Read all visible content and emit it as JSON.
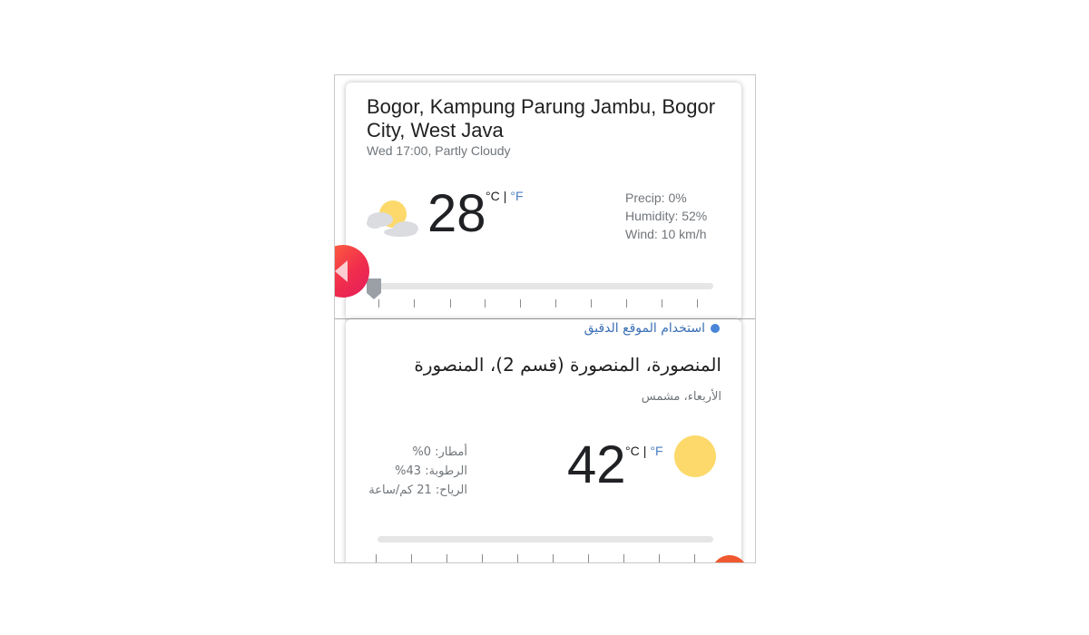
{
  "top_card": {
    "location": "Bogor, Kampung Parung Jambu, Bogor City, West Java",
    "subtitle": "Wed 17:00, Partly Cloudy",
    "icon": "partly-cloudy-icon",
    "temperature": "28",
    "unit_c": "°C",
    "unit_sep": "|",
    "unit_f": "°F",
    "precip": "Precip: 0%",
    "humidity": "Humidity: 52%",
    "wind": "Wind: 10 km/h"
  },
  "bottom_card": {
    "precise_location": "استخدام الموقع الدقيق",
    "location": "المنصورة، المنصورة (قسم 2)، المنصورة",
    "subtitle": "الأربعاء، مشمس",
    "icon": "sun-icon",
    "temperature": "42",
    "unit_c": "°C",
    "unit_sep": "|",
    "unit_f": "°F",
    "precip": "أمطار: 0%",
    "humidity": "الرطوبة: 43%",
    "wind": "الرياح: 21 كم/ساعة"
  },
  "colors": {
    "accent_blue": "#4a7fc1",
    "sun_yellow": "#fcd96a",
    "fab_red": "#f12d4d",
    "text_primary": "#202124",
    "text_secondary": "#70757a"
  }
}
